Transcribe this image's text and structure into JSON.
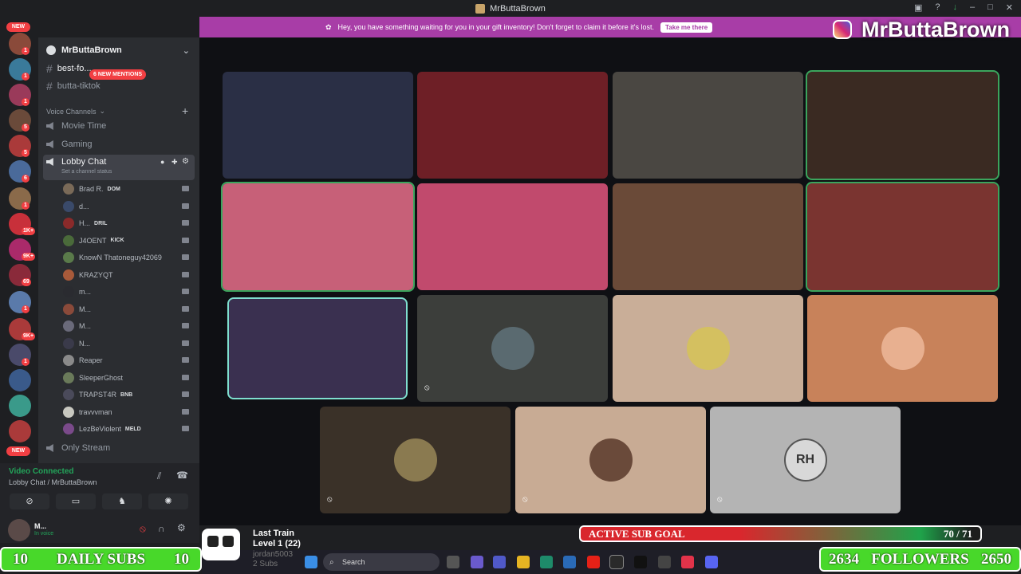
{
  "window": {
    "title": "MrButtaBrown"
  },
  "notice": {
    "text": "Hey, you have something waiting for you in your gift inventory! Don't forget to claim it before it's lost.",
    "button": "Take me there"
  },
  "overlay": {
    "instagram_handle": "MrButtaBrown"
  },
  "rail": {
    "new_top": "NEW",
    "new_bottom": "NEW",
    "badges": [
      "1",
      "1",
      "1",
      "5",
      "5",
      "6",
      "1",
      "1K+",
      "9K+",
      "69",
      "1",
      "9K+",
      "1"
    ]
  },
  "sidebar": {
    "server_name": "MrButtaBrown",
    "text_channels": [
      {
        "label": "best-fo..."
      },
      {
        "label": "butta-tiktok"
      }
    ],
    "mentions_pill": "6 NEW MENTIONS",
    "voice_category": "Voice Channels",
    "voice_channels": [
      {
        "label": "Movie Time"
      },
      {
        "label": "Gaming"
      },
      {
        "label": "Lobby Chat"
      }
    ],
    "channel_status": "Set a channel status",
    "members": [
      {
        "name": "Brad R.",
        "tag": "DOM",
        "color": "#7a6a58"
      },
      {
        "name": "d...",
        "tag": "",
        "color": "#3a4a6a"
      },
      {
        "name": "H...",
        "tag": "DRIL",
        "color": "#8a2a2a"
      },
      {
        "name": "J4OENT",
        "tag": "KICK",
        "color": "#4a6a3a"
      },
      {
        "name": "KnowN Thatoneguy42069",
        "tag": "",
        "color": "#5a7a4a"
      },
      {
        "name": "KRAZYQT",
        "tag": "",
        "color": "#a85a3a"
      },
      {
        "name": "m...",
        "tag": "",
        "color": "#2a2b30"
      },
      {
        "name": "M...",
        "tag": "",
        "color": "#8a4a3a"
      },
      {
        "name": "M...",
        "tag": "",
        "color": "#6a6a7a"
      },
      {
        "name": "N...",
        "tag": "",
        "color": "#3a3a4a"
      },
      {
        "name": "Reaper",
        "tag": "",
        "color": "#8a8a8a"
      },
      {
        "name": "SleeperGhost",
        "tag": "",
        "color": "#6a7a5a"
      },
      {
        "name": "TRAPST4R",
        "tag": "BNB",
        "color": "#4a4a5a"
      },
      {
        "name": "travvvman",
        "tag": "",
        "color": "#c8c8c0"
      },
      {
        "name": "LezBeViolent",
        "tag": "MELD",
        "color": "#7a4a8a"
      }
    ],
    "only_stream": "Only Stream"
  },
  "voice": {
    "status": "Video Connected",
    "location": "Lobby Chat / MrButtaBrown",
    "user": "M...",
    "user_status": "In voice"
  },
  "tiles": [
    {
      "color": "#2a2f45",
      "speaking": false
    },
    {
      "color": "#6e1f26",
      "speaking": false
    },
    {
      "color": "#4a4742",
      "speaking": false
    },
    {
      "color": "#3a2a22",
      "speaking": true
    },
    {
      "color": "#c76078",
      "speaking": true
    },
    {
      "color": "#c14a6d",
      "speaking": false
    },
    {
      "color": "#6a4a38",
      "speaking": false
    },
    {
      "color": "#7a3430",
      "speaking": true
    },
    {
      "color": "#3a3050",
      "speaking": true
    },
    {
      "color": "#3c3e3b",
      "speaking": false,
      "avatar": "#5a6a70"
    },
    {
      "color": "#c9ae98",
      "speaking": false,
      "avatar": "#d4c060"
    },
    {
      "color": "#c8825a",
      "speaking": false,
      "avatar": "#e8b090"
    },
    {
      "color": "#3a3128",
      "speaking": false,
      "avatar": "#8a7a50"
    },
    {
      "color": "#c8ab94",
      "speaking": false,
      "avatar": "#6a4a3a"
    },
    {
      "color": "#b4b4b4",
      "speaking": false,
      "avatar": "#d8d8d8",
      "avatar_text": "RH"
    }
  ],
  "daily_subs": {
    "left": "10",
    "label": "DAILY SUBS",
    "right": "10"
  },
  "followers": {
    "left": "2634",
    "label": "FOLLOWERS",
    "right": "2650"
  },
  "sub_goal": {
    "label": "ACTIVE SUB GOAL",
    "value": "70 / 71"
  },
  "train": {
    "title": "Last Train",
    "level": "Level 1  (22)",
    "user": "jordan5003",
    "subs": "2 Subs"
  },
  "taskbar": {
    "search": "Search"
  }
}
